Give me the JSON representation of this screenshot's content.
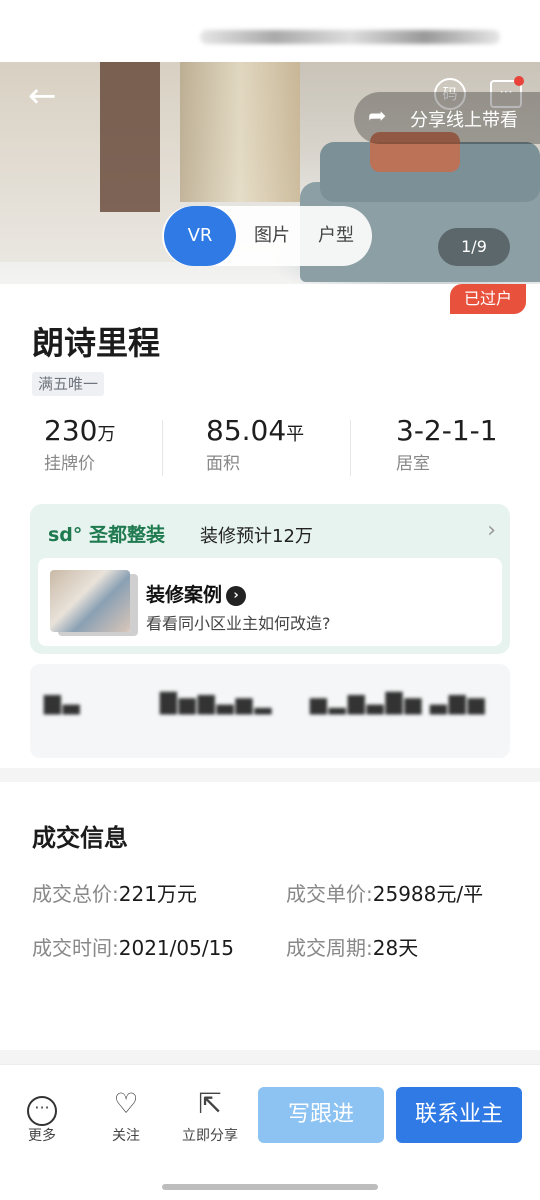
{
  "hero": {
    "share_label": "分享线上带看",
    "qr_label": "码",
    "media_tabs": [
      "VR",
      "图片",
      "户型"
    ],
    "counter": "1/9",
    "stamp": "已过户"
  },
  "listing": {
    "title": "朗诗里程",
    "tag": "满五唯一",
    "stats": [
      {
        "value": "230",
        "unit": "万",
        "label": "挂牌价"
      },
      {
        "value": "85.04",
        "unit": "平",
        "label": "面积"
      },
      {
        "value": "3-2-1-1",
        "unit": "",
        "label": "居室"
      }
    ]
  },
  "decoration": {
    "brand": "sd° 圣都整装",
    "budget": "装修预计12万",
    "case_title": "装修案例",
    "case_sub": "看看同小区业主如何改造?"
  },
  "deal": {
    "title": "成交信息",
    "total_label": "成交总价:",
    "total_value": "221万元",
    "unit_label": "成交单价:",
    "unit_value": "25988元/平",
    "date_label": "成交时间:",
    "date_value": "2021/05/15",
    "cycle_label": "成交周期:",
    "cycle_value": "28天"
  },
  "bottom": {
    "more": "更多",
    "follow": "关注",
    "share": "立即分享",
    "write_follow": "写跟进",
    "contact": "联系业主"
  },
  "colors": {
    "primary": "#2f7ae5",
    "primary_light": "#8cc3f2",
    "stamp": "#e8523d"
  }
}
